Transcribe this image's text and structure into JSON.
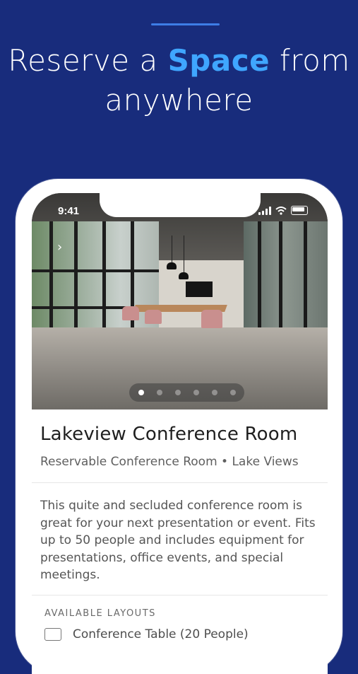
{
  "promo": {
    "headline_pre": "Reserve a ",
    "headline_highlight": "Space",
    "headline_post": " from",
    "headline_line2": "anywhere"
  },
  "status_bar": {
    "time": "9:41"
  },
  "carousel": {
    "total": 6,
    "active": 1
  },
  "room": {
    "title": "Lakeview Conference Room",
    "subtitle": "Reservable Conference Room  •  Lake Views",
    "description": "This quite and secluded conference room is great for your next presentation or event. Fits up to 50 people and includes equipment for presentations, office events, and special meetings."
  },
  "layouts": {
    "label": "AVAILABLE LAYOUTS",
    "items": [
      {
        "label": "Conference Table (20 People)",
        "icon": "table-icon"
      }
    ]
  },
  "colors": {
    "background": "#182c7c",
    "accent": "#3fa6ff",
    "accent_line": "#3d7de6"
  }
}
